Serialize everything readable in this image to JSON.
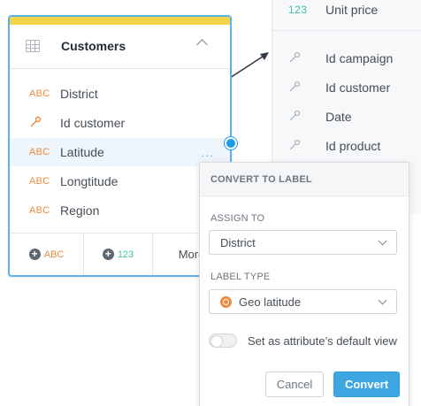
{
  "dataset": {
    "rows": [
      {
        "icon": "number-icon",
        "type_label": "123",
        "label": "Unit price"
      },
      {
        "icon": "key-icon",
        "type_label": "",
        "label": "Id campaign"
      },
      {
        "icon": "key-icon",
        "type_label": "",
        "label": "Id customer"
      },
      {
        "icon": "key-icon",
        "type_label": "",
        "label": "Date"
      },
      {
        "icon": "key-icon",
        "type_label": "",
        "label": "Id product"
      }
    ]
  },
  "customers": {
    "title": "Customers",
    "fields": [
      {
        "type": "ABC",
        "label": "District"
      },
      {
        "type": "key",
        "label": "Id customer"
      },
      {
        "type": "ABC",
        "label": "Latitude",
        "highlighted": true
      },
      {
        "type": "ABC",
        "label": "Longtitude"
      },
      {
        "type": "ABC",
        "label": "Region"
      }
    ],
    "more_dots": "...",
    "footer": {
      "add_attribute": "ABC",
      "add_fact": "123",
      "more": "More"
    }
  },
  "convert_popover": {
    "title": "CONVERT TO LABEL",
    "assign_to_label": "ASSIGN TO",
    "assign_to_value": "District",
    "label_type_label": "LABEL TYPE",
    "label_type_value": "Geo latitude",
    "default_view_label": "Set as attribute’s default view",
    "default_view_enabled": false,
    "cancel_label": "Cancel",
    "convert_label": "Convert"
  },
  "colors": {
    "accent_blue": "#1d9ce5",
    "attribute_orange": "#ef8a3c",
    "fact_green": "#3ec2a6",
    "dataset_yellow": "#f3d34a"
  }
}
